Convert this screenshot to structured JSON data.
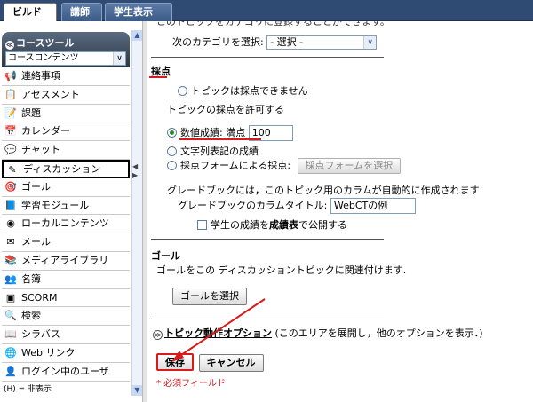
{
  "tabs": {
    "build": "ビルド",
    "instructor": "講師",
    "student": "学生表示"
  },
  "sidebar": {
    "title": "コースツール",
    "selector_value": "コースコンテンツ",
    "items": [
      {
        "label": "連絡事項",
        "icon": "megaphone-icon",
        "glyph": "📢"
      },
      {
        "label": "アセスメント",
        "icon": "assessment-icon",
        "glyph": "📋"
      },
      {
        "label": "課題",
        "icon": "assignment-icon",
        "glyph": "📝"
      },
      {
        "label": "カレンダー",
        "icon": "calendar-icon",
        "glyph": "📅"
      },
      {
        "label": "チャット",
        "icon": "chat-icon",
        "glyph": "💬"
      },
      {
        "label": "ディスカッション",
        "icon": "discussion-icon",
        "glyph": "✎",
        "active": true
      },
      {
        "label": "ゴール",
        "icon": "goal-icon",
        "glyph": "🎯"
      },
      {
        "label": "学習モジュール",
        "icon": "learning-module-icon",
        "glyph": "📘"
      },
      {
        "label": "ローカルコンテンツ",
        "icon": "local-content-icon",
        "glyph": "◉"
      },
      {
        "label": "メール",
        "icon": "mail-icon",
        "glyph": "✉"
      },
      {
        "label": "メディアライブラリ",
        "icon": "media-library-icon",
        "glyph": "📚"
      },
      {
        "label": "名簿",
        "icon": "roster-icon",
        "glyph": "👥"
      },
      {
        "label": "SCORM",
        "icon": "scorm-icon",
        "glyph": "▣"
      },
      {
        "label": "検索",
        "icon": "search-icon",
        "glyph": "🔍"
      },
      {
        "label": "シラバス",
        "icon": "syllabus-icon",
        "glyph": "📖"
      },
      {
        "label": "Web リンク",
        "icon": "web-link-icon",
        "glyph": "🌐"
      },
      {
        "label": "ログイン中のユーザ",
        "icon": "logged-in-users-icon",
        "glyph": "👤"
      }
    ],
    "footer": "(H) = 非表示"
  },
  "main": {
    "truncated_top": "このトピックをカテゴリに登録することができます。",
    "next_category_label": "次のカテゴリを選択:",
    "next_category_value": "- 選択 -",
    "grading_heading": "採点",
    "no_grading_option": "トピックは採点できません",
    "allow_grading_label": "トピックの採点を許可する",
    "numeric_label": "数値成績: 満点",
    "numeric_value": "100",
    "text_grade_option": "文字列表記の成績",
    "form_grade_option": "採点フォームによる採点:",
    "form_select_button": "採点フォームを選択",
    "gradebook_note": "グレードブックには，このトピック用のカラムが自動的に作成されます",
    "column_title_label": "グレードブックのカラムタイトル:",
    "column_title_value": "WebCTの例",
    "publish_prefix": "学生の成績を",
    "publish_bold": "成績表",
    "publish_suffix": "で公開する",
    "goal_heading": "ゴール",
    "goal_description": "ゴールをこの ディスカッショントピックに関連付けます.",
    "goal_button": "ゴールを選択",
    "topic_actions_link": "トピック動作オプション",
    "topic_actions_note": "(このエリアを展開し，他のオプションを表示．)",
    "save_button": "保存",
    "cancel_button": "キャンセル",
    "required_note": "* 必須フィールド"
  },
  "colors": {
    "accent_red": "#d81a1a",
    "header_navy": "#2f4a73"
  }
}
